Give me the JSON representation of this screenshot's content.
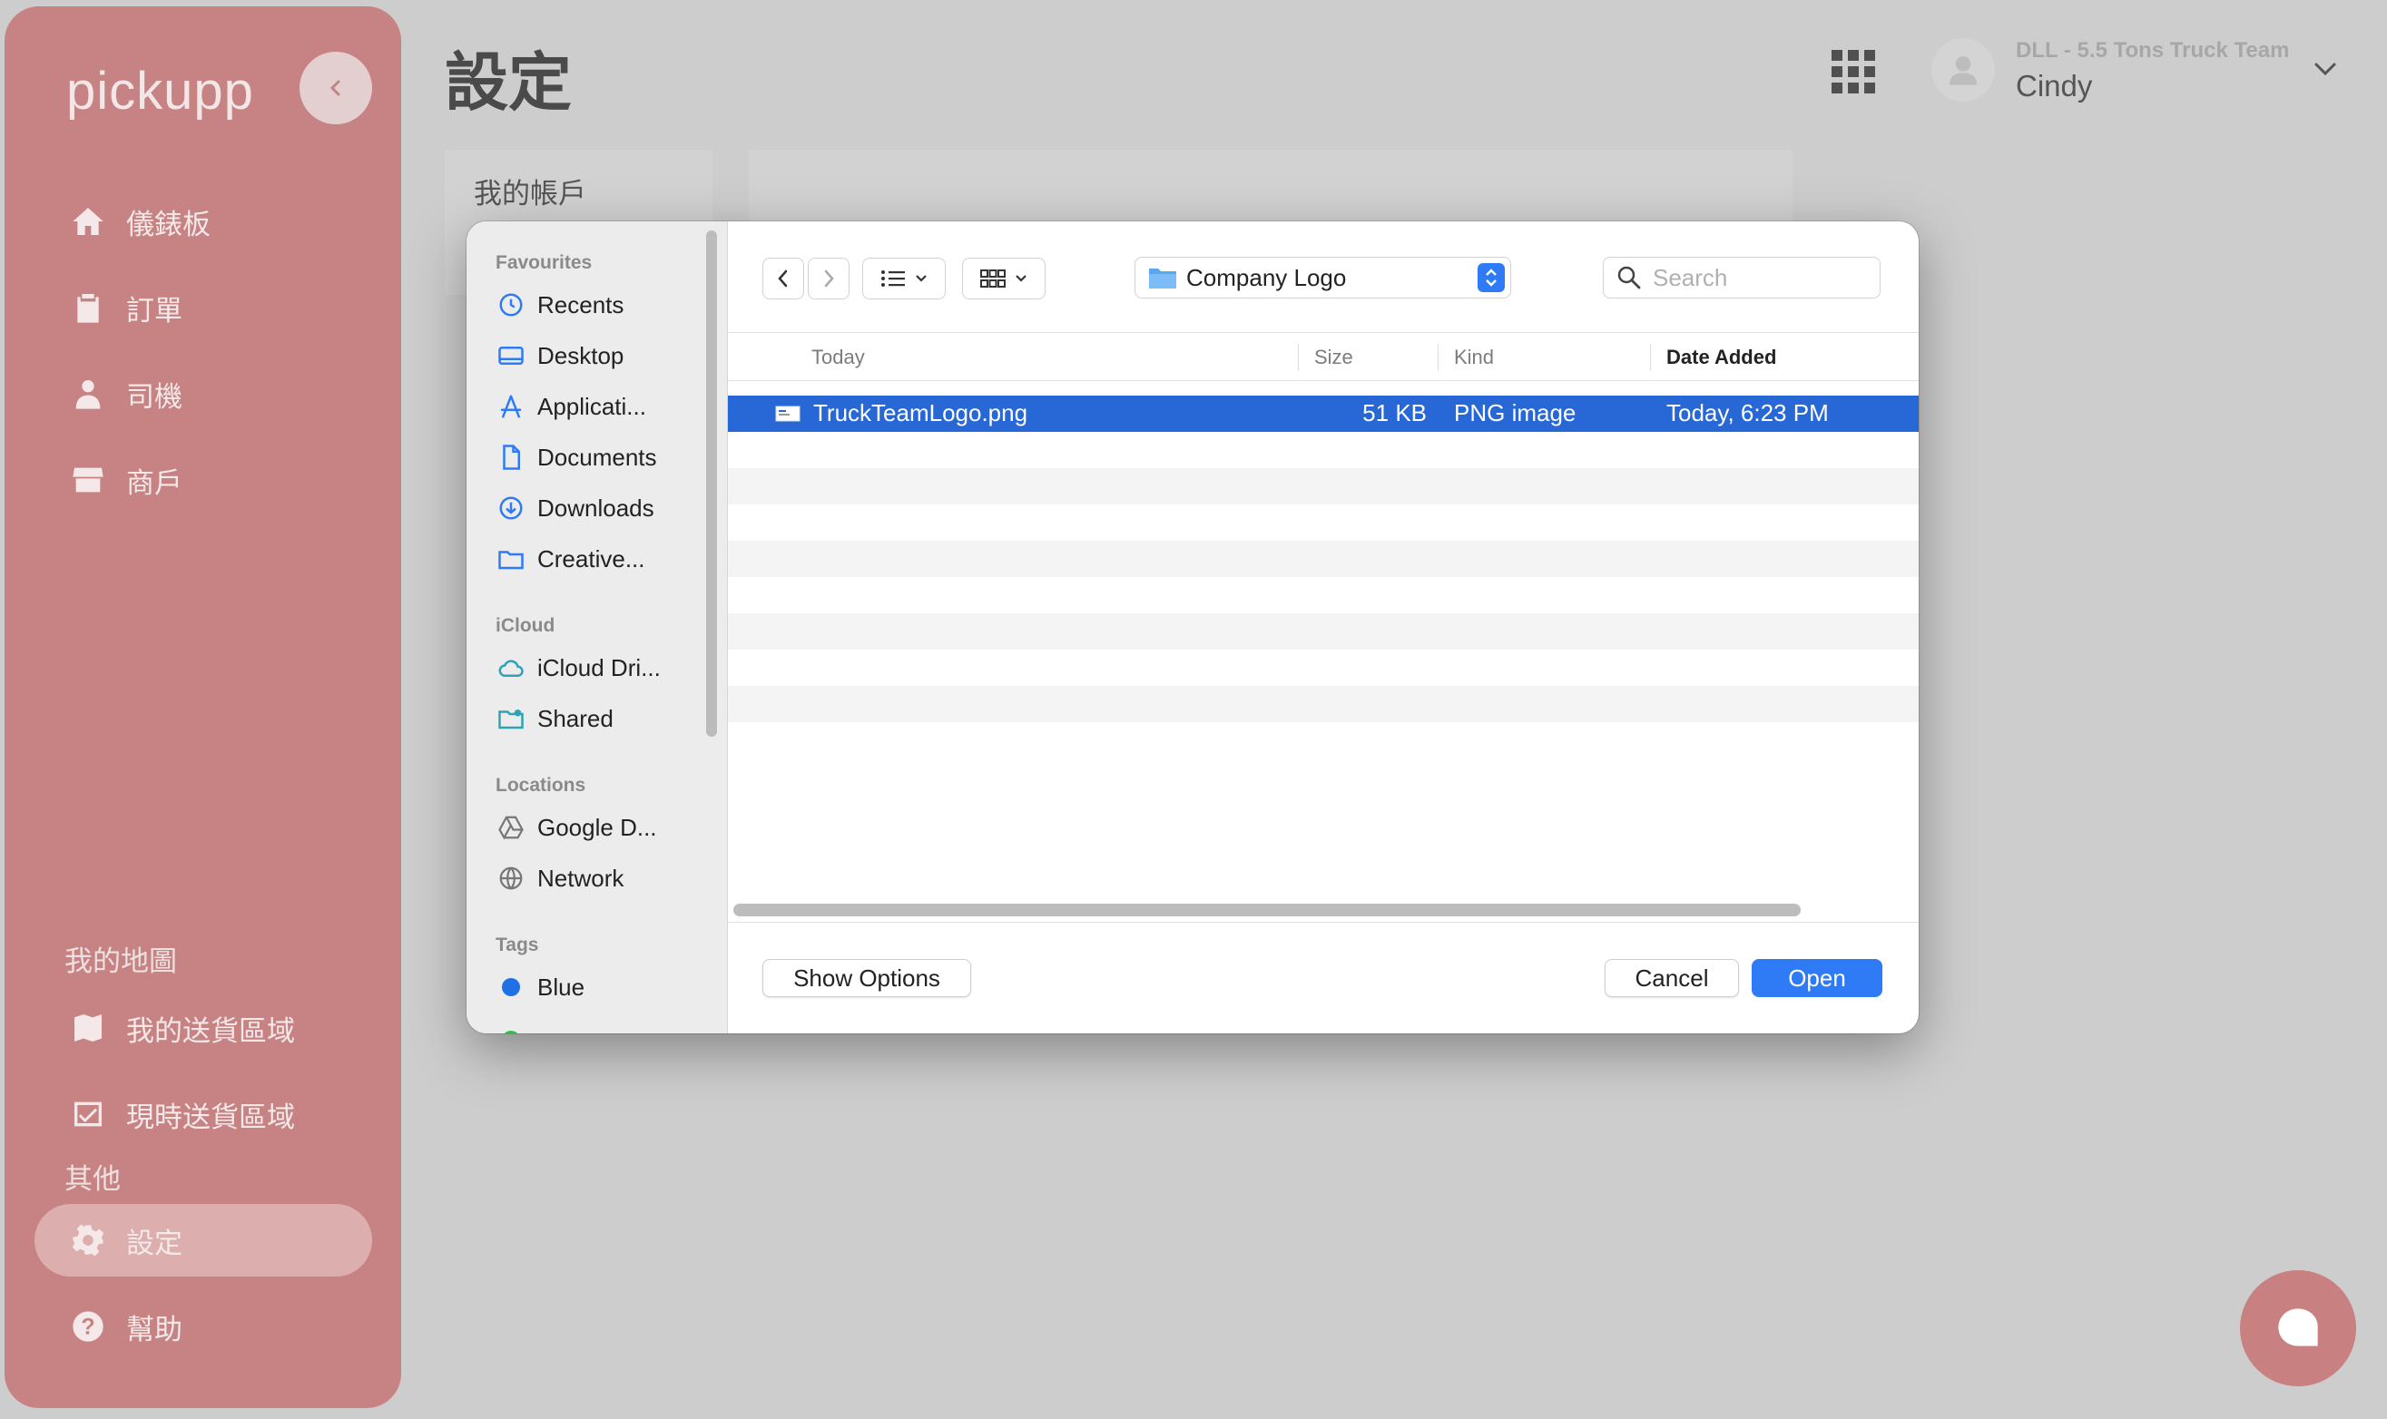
{
  "app": {
    "logo": "pickupp",
    "page_title": "設定",
    "tab_label": "我的帳戶",
    "team_name": "DLL - 5.5 Tons Truck Team",
    "user_name": "Cindy"
  },
  "sidebar": {
    "items": [
      {
        "label": "儀錶板",
        "icon": "home-icon"
      },
      {
        "label": "訂單",
        "icon": "clipboard-icon"
      },
      {
        "label": "司機",
        "icon": "driver-icon"
      },
      {
        "label": "商戶",
        "icon": "store-icon"
      }
    ],
    "map_section": "我的地圖",
    "map_items": [
      {
        "label": "我的送貨區域",
        "icon": "map-icon"
      },
      {
        "label": "現時送貨區域",
        "icon": "checkbox-icon"
      }
    ],
    "other_section": "其他",
    "settings_label": "設定",
    "help_label": "幫助"
  },
  "dialog": {
    "favourites_heading": "Favourites",
    "favourites": [
      "Recents",
      "Desktop",
      "Applicati...",
      "Documents",
      "Downloads",
      "Creative..."
    ],
    "icloud_heading": "iCloud",
    "icloud": [
      "iCloud Dri...",
      "Shared"
    ],
    "locations_heading": "Locations",
    "locations": [
      "Google D...",
      "Network"
    ],
    "tags_heading": "Tags",
    "tags": [
      {
        "label": "Blue",
        "color": "#1f6fe5"
      }
    ],
    "location": "Company Logo",
    "search_placeholder": "Search",
    "columns": {
      "name": "Today",
      "size": "Size",
      "kind": "Kind",
      "date": "Date Added"
    },
    "file": {
      "name": "TruckTeamLogo.png",
      "size": "51 KB",
      "kind": "PNG image",
      "date": "Today, 6:23 PM"
    },
    "show_options": "Show Options",
    "cancel": "Cancel",
    "open": "Open"
  },
  "colors": {
    "sidebar_bg": "#c78383",
    "selection": "#2768d6",
    "primary_button": "#2f7bf5"
  }
}
